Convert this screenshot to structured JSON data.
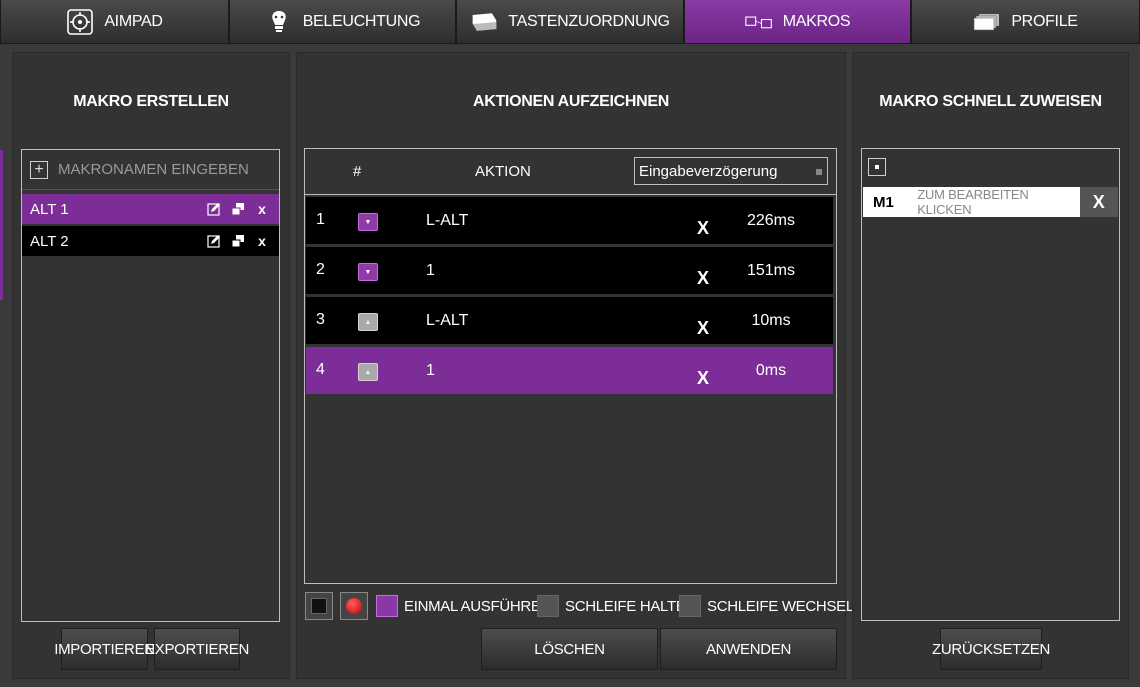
{
  "tabs": [
    {
      "label": "AIMPAD",
      "icon": "crosshair-icon"
    },
    {
      "label": "BELEUCHTUNG",
      "icon": "lightbulb-icon"
    },
    {
      "label": "TASTENZUORDNUNG",
      "icon": "keyboard-icon"
    },
    {
      "label": "MAKROS",
      "icon": "macro-icon",
      "active": true
    },
    {
      "label": "PROFILE",
      "icon": "profiles-icon"
    }
  ],
  "left": {
    "title": "MAKRO ERSTELLEN",
    "name_placeholder": "MAKRONAMEN EINGEBEN",
    "macros": [
      {
        "label": "ALT 1",
        "selected": true
      },
      {
        "label": "ALT 2",
        "selected": false
      }
    ],
    "import_label": "IMPORTIEREN",
    "export_label": "EXPORTIEREN"
  },
  "middle": {
    "title": "AKTIONEN AUFZEICHNEN",
    "col_num": "#",
    "col_action": "AKTION",
    "delay_select": "Eingabeverzögerung",
    "rows": [
      {
        "num": "1",
        "key": "down",
        "action": "L-ALT",
        "x": "X",
        "ms": "226ms"
      },
      {
        "num": "2",
        "key": "down",
        "action": "1",
        "x": "X",
        "ms": "151ms"
      },
      {
        "num": "3",
        "key": "up",
        "action": "L-ALT",
        "x": "X",
        "ms": "10ms"
      },
      {
        "num": "4",
        "key": "up",
        "action": "1",
        "x": "X",
        "ms": "0ms"
      }
    ],
    "opt_once": "EINMAL AUSFÜHREN",
    "opt_hold": "SCHLEIFE HALTEN",
    "opt_toggle": "SCHLEIFE WECHSELN",
    "delete_label": "LÖSCHEN",
    "apply_label": "ANWENDEN"
  },
  "right": {
    "title": "MAKRO SCHNELL ZUWEISEN",
    "assign_key": "M1",
    "assign_hint": "ZUM BEARBEITEN KLICKEN",
    "assign_x": "X",
    "reset_label": "ZURÜCKSETZEN"
  },
  "colors": {
    "accent": "#7d2d97",
    "panel": "#333333",
    "row": "#000000"
  }
}
